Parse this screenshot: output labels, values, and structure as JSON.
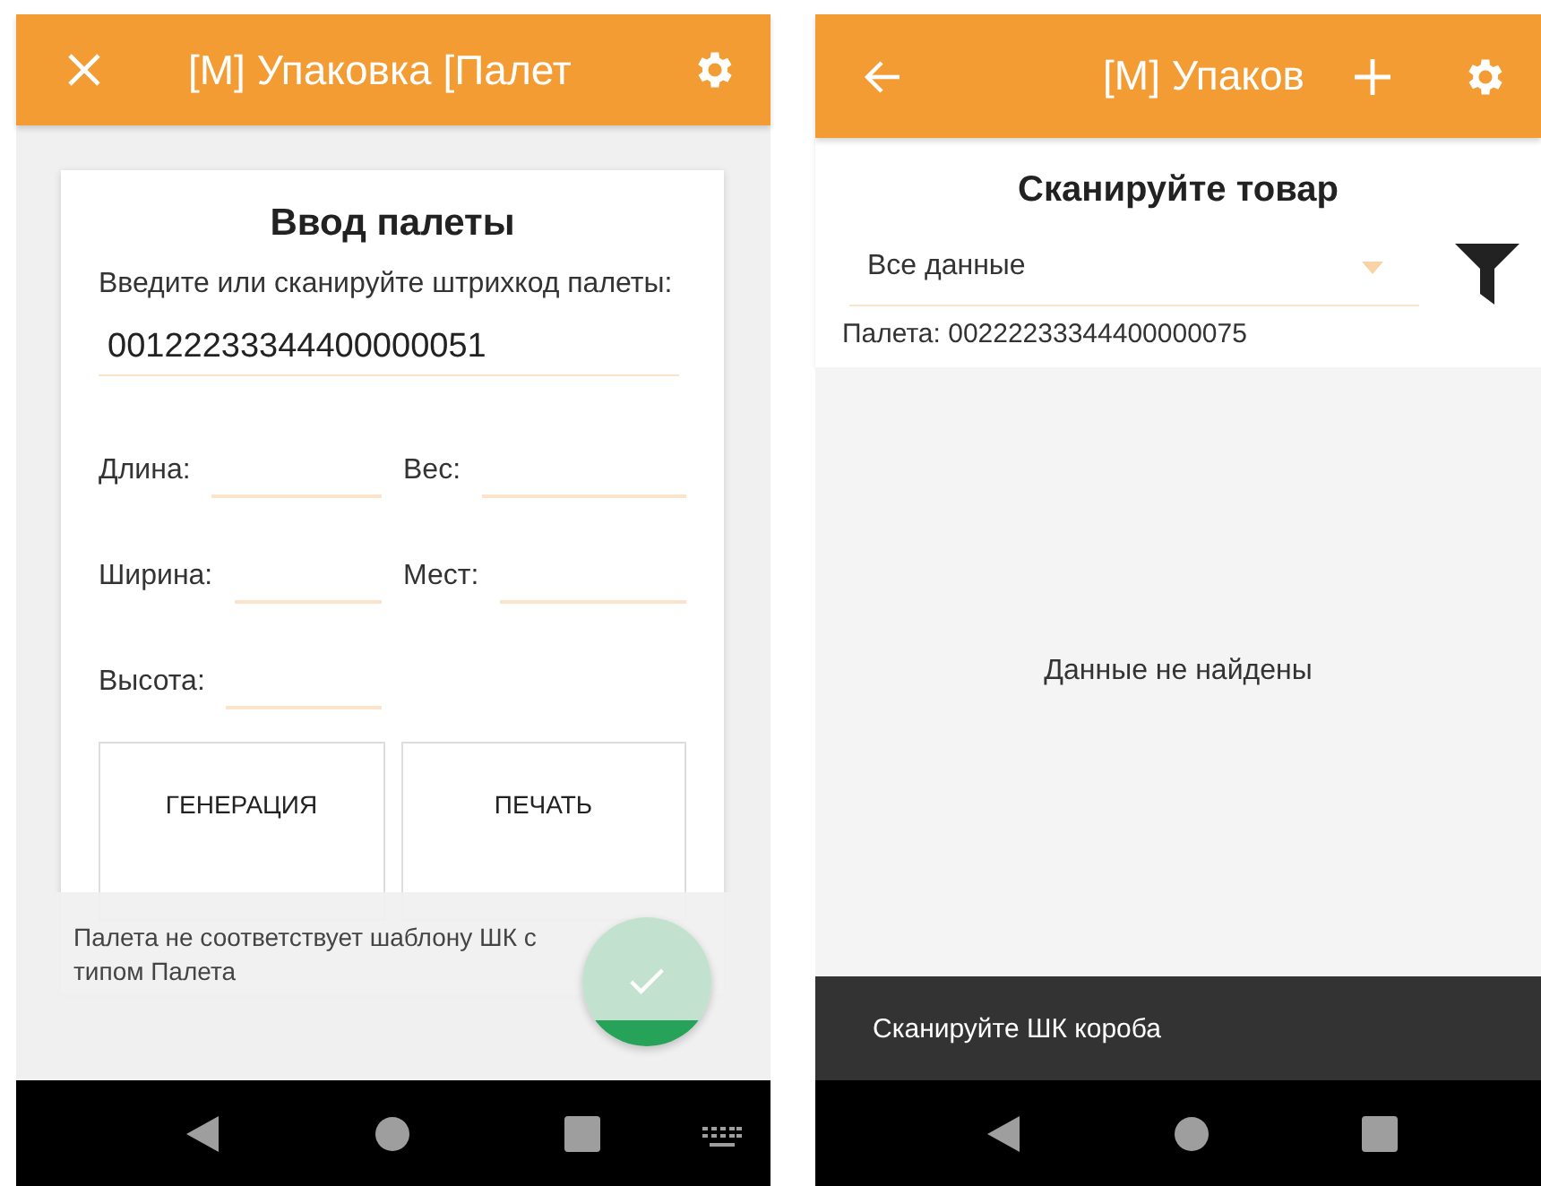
{
  "packing_form_screen": {
    "app_bar": {
      "title": "[М] Упаковка [Палет"
    },
    "card": {
      "title": "Ввод палеты",
      "prompt": "Введите или сканируйте штрихкод палеты:",
      "barcode_value": "00122233344400000051",
      "fields": [
        {
          "label": "Длина:"
        },
        {
          "label": "Вес:"
        },
        {
          "label": "Ширина:"
        },
        {
          "label": "Мест:"
        },
        {
          "label": "Высота:"
        }
      ],
      "buttons": [
        "ГЕНЕРАЦИЯ",
        "ПЕЧАТЬ"
      ]
    },
    "toast": "Палета не соответствует шаблону ШК с типом Палета"
  },
  "scan_screen": {
    "app_bar": {
      "title": "[М] Упаков"
    },
    "heading": "Сканируйте товар",
    "filter_dropdown": {
      "value": "Все данные"
    },
    "pallet_info": "Палета: 00222233344400000075",
    "empty_message": "Данные не найдены",
    "snackbar": "Сканируйте ШК короба"
  }
}
